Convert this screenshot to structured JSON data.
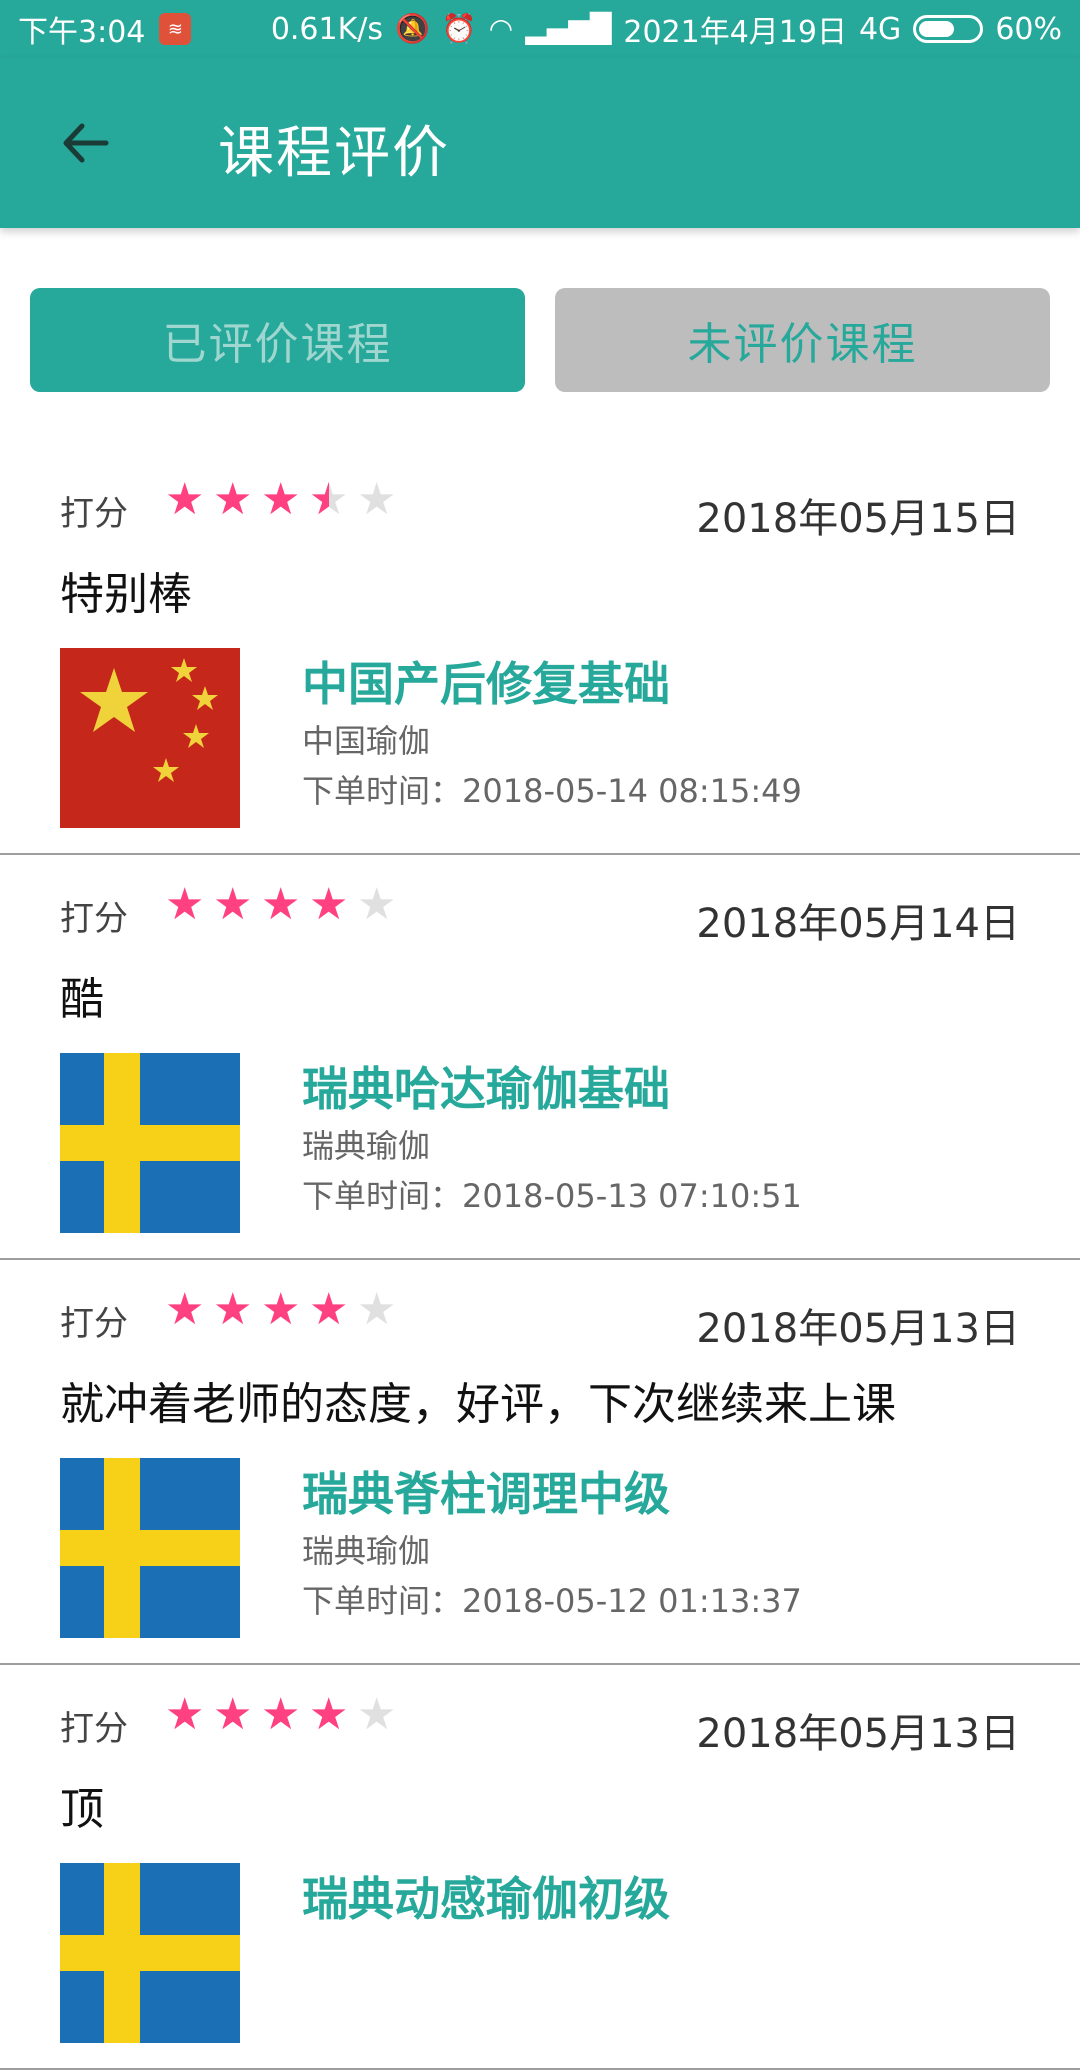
{
  "status_bar": {
    "time": "下午3:04",
    "speed": "0.61K/s",
    "date": "2021年4月19日",
    "network": "4G",
    "battery_percent": "60%",
    "battery_level": 0.6
  },
  "app_bar": {
    "title": "课程评价",
    "background": "#26a89a"
  },
  "tabs": [
    {
      "label": "已评价课程",
      "active": true
    },
    {
      "label": "未评价课程",
      "active": false
    }
  ],
  "reviews": [
    {
      "rating_label": "打分",
      "rating": 3.5,
      "date": "2018年05月15日",
      "comment": "特别棒",
      "flag": "china",
      "course_title": "中国产后修复基础",
      "course_category": "中国瑜伽",
      "order_time": "下单时间：2018-05-14 08:15:49"
    },
    {
      "rating_label": "打分",
      "rating": 4,
      "date": "2018年05月14日",
      "comment": "酷",
      "flag": "sweden",
      "course_title": "瑞典哈达瑜伽基础",
      "course_category": "瑞典瑜伽",
      "order_time": "下单时间：2018-05-13 07:10:51"
    },
    {
      "rating_label": "打分",
      "rating": 4,
      "date": "2018年05月13日",
      "comment": "就冲着老师的态度，好评，下次继续来上课",
      "flag": "sweden",
      "course_title": "瑞典脊柱调理中级",
      "course_category": "瑞典瑜伽",
      "order_time": "下单时间：2018-05-12 01:13:37"
    },
    {
      "rating_label": "打分",
      "rating": 4,
      "date": "2018年05月13日",
      "comment": "顶",
      "flag": "sweden",
      "course_title": "瑞典动感瑜伽初级",
      "course_category": "",
      "order_time": ""
    }
  ],
  "colors": {
    "accent": "#26a89a",
    "star_on": "#ff4081",
    "star_off": "#e0e0e0"
  }
}
